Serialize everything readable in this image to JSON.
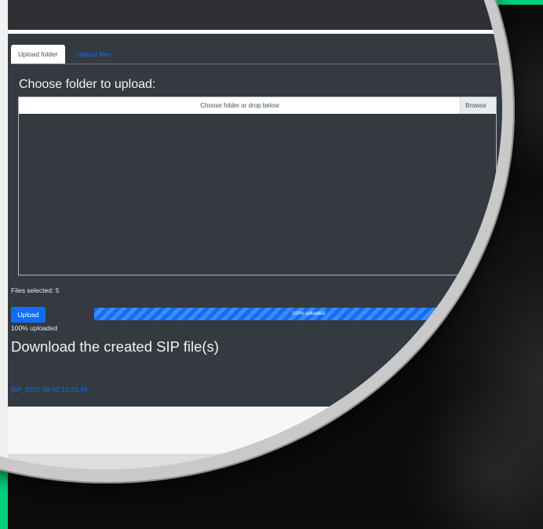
{
  "tabs": [
    {
      "label": "Upload folder",
      "active": true
    },
    {
      "label": "Upload files",
      "active": false
    }
  ],
  "upload": {
    "heading": "Choose folder to upload:",
    "input_label": "Choose folder or drop below",
    "browse_label": "Browse",
    "files_selected": "Files selected: 5",
    "upload_button": "Upload",
    "progress_percent": 100,
    "progress_label": "100% uploaded",
    "status_text": "100% uploaded"
  },
  "download": {
    "heading": "Download the created SIP file(s)",
    "files": [
      "SIP_2022-09-02 10:21:49"
    ]
  },
  "colors": {
    "accent_green": "#00d17a",
    "panel_bg": "#343a40",
    "primary_blue": "#0d6efd"
  }
}
